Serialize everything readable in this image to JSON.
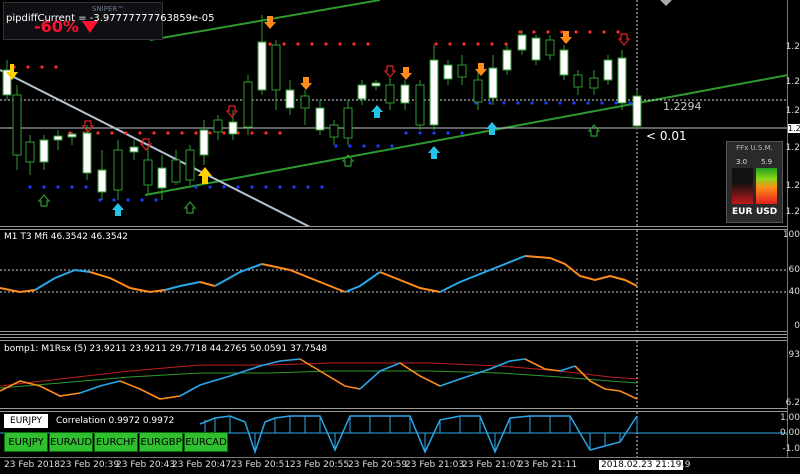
{
  "top_bar": {
    "label": "pipdiffCurrent = -3.97777777763859e-05",
    "badge_text": "-60%",
    "logo_text": "SNIPER™"
  },
  "main_chart": {
    "price_label": "1.2294",
    "diff_label": "< 0.01",
    "y_ticks": [
      "1.2",
      "1.2",
      "1.2",
      "1.2",
      "1.2",
      "1.2",
      "1.2",
      "1.2"
    ],
    "current_price_tag": "1.2"
  },
  "ffx_widget": {
    "title": "FFx U.S.M.",
    "value_left": "3.0",
    "value_right": "5.9",
    "pair_left": "EUR",
    "pair_right": "USD",
    "colors": {
      "left": "#c01818",
      "right": "#1fa01f"
    }
  },
  "indicator_t3": {
    "header": "M1  T3 Mfi  46.3542 46.3542",
    "levels": [
      "100",
      "60",
      "40",
      "0"
    ],
    "colors": {
      "up": "#2aa7e8",
      "down": "#ff8c1a"
    }
  },
  "indicator_rsx": {
    "header": "bomp1: M1Rsx (5) 23.9211 23.9211 29.7718 44.2765 50.0591 37.7548",
    "levels": [
      "93",
      "6.2"
    ]
  },
  "indicator_corr": {
    "symbol_box": "EURJPY",
    "header": "Correlation 0.9972 0.9972",
    "levels": [
      "1.00",
      "0.00",
      "-1.0"
    ],
    "symbols": [
      "EURJPY",
      "EURAUD",
      "EURCHF",
      "EURGBP",
      "EURCAD"
    ]
  },
  "x_axis": {
    "labels": [
      "23 Feb 2018",
      "23 Feb 20:39",
      "23 Feb 20:43",
      "23 Feb 20:47",
      "23 Feb 20:51",
      "23 Feb 20:55",
      "23 Feb 20:59",
      "23 Feb 21:03",
      "23 Feb 21:07",
      "23 Feb 21:11",
      "2018.02.23 21:19",
      ":19"
    ]
  }
}
